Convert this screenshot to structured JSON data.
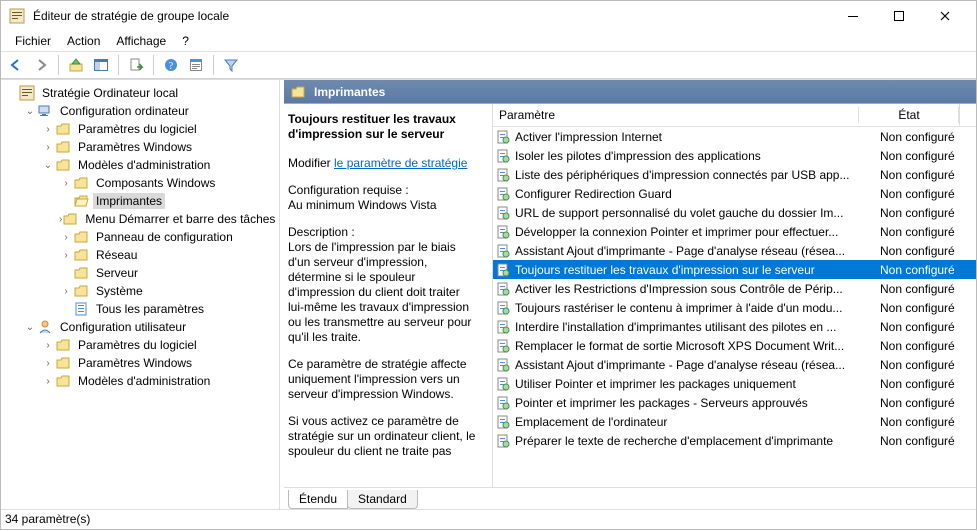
{
  "title": "Éditeur de stratégie de groupe locale",
  "menu": {
    "file": "Fichier",
    "action": "Action",
    "view": "Affichage",
    "help": "?"
  },
  "tree": {
    "root": "Stratégie Ordinateur local",
    "computer": {
      "label": "Configuration ordinateur",
      "software": "Paramètres du logiciel",
      "windows": "Paramètres Windows",
      "templates": {
        "label": "Modèles d'administration",
        "components": "Composants Windows",
        "printers": "Imprimantes",
        "startmenu": "Menu Démarrer et barre des tâches",
        "controlpanel": "Panneau de configuration",
        "network": "Réseau",
        "server": "Serveur",
        "system": "Système",
        "all": "Tous les paramètres"
      }
    },
    "user": {
      "label": "Configuration utilisateur",
      "software": "Paramètres du logiciel",
      "windows": "Paramètres Windows",
      "templates": "Modèles d'administration"
    }
  },
  "header": {
    "title": "Imprimantes"
  },
  "detail": {
    "selected_title": "Toujours restituer les travaux d'impression sur le serveur",
    "edit_prefix": "Modifier ",
    "edit_link": "le paramètre de stratégie",
    "req_label": "Configuration requise :",
    "req_value": "Au minimum Windows Vista",
    "desc_label": "Description :",
    "desc_body": "Lors de l'impression par le biais d'un serveur d'impression, détermine si le spouleur d'impression du client doit traiter lui-même les travaux d'impression ou les transmettre au serveur pour qu'il les traite.",
    "desc_body2": "Ce paramètre de stratégie affecte uniquement l'impression vers un serveur d'impression Windows.",
    "desc_body3": "Si vous activez ce paramètre de stratégie sur un ordinateur client, le spouleur du client ne traite pas"
  },
  "columns": {
    "param": "Paramètre",
    "state": "État"
  },
  "state_default": "Non configuré",
  "list": [
    {
      "label": "Activer l'impression Internet"
    },
    {
      "label": "Isoler les pilotes d'impression des applications"
    },
    {
      "label": "Liste des périphériques d'impression connectés par USB app..."
    },
    {
      "label": "Configurer Redirection Guard"
    },
    {
      "label": "URL de support personnalisé du volet gauche du dossier Im..."
    },
    {
      "label": "Développer la connexion Pointer et imprimer pour effectuer..."
    },
    {
      "label": "Assistant Ajout d'imprimante - Page d'analyse réseau (résea..."
    },
    {
      "label": "Toujours restituer les travaux d'impression sur le serveur",
      "selected": true
    },
    {
      "label": "Activer les Restrictions d'Impression sous Contrôle de Périp..."
    },
    {
      "label": "Toujours rastériser le contenu à imprimer à l'aide d'un modu..."
    },
    {
      "label": "Interdire l'installation d'imprimantes utilisant des pilotes en ..."
    },
    {
      "label": "Remplacer le format de sortie Microsoft XPS Document Writ..."
    },
    {
      "label": "Assistant Ajout d'imprimante - Page d'analyse réseau (résea..."
    },
    {
      "label": "Utiliser Pointer et imprimer les packages uniquement"
    },
    {
      "label": "Pointer et imprimer les packages - Serveurs approuvés"
    },
    {
      "label": "Emplacement de l'ordinateur"
    },
    {
      "label": "Préparer le texte de recherche d'emplacement d'imprimante"
    }
  ],
  "tabs": {
    "extended": "Étendu",
    "standard": "Standard"
  },
  "status": "34 paramètre(s)"
}
